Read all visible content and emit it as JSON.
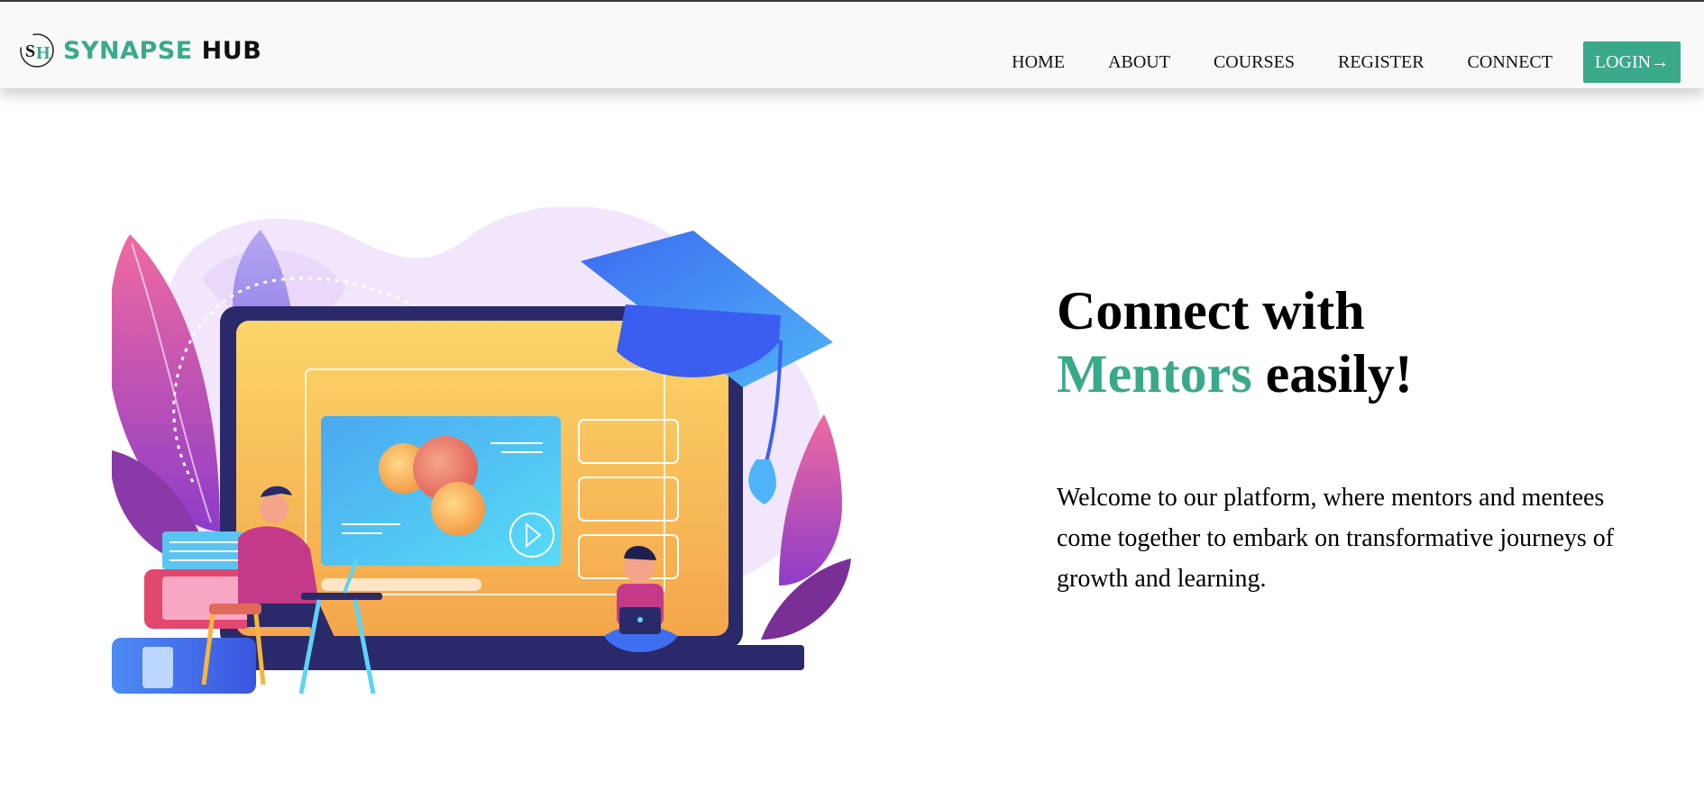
{
  "brand": {
    "logo_text": "SH",
    "name_part1": "SYNAPSE",
    "name_part2": "HUB"
  },
  "nav": {
    "home": "HOME",
    "about": "ABOUT",
    "courses": "COURSES",
    "register": "REGISTER",
    "connect": "CONNECT",
    "login": "LOGIN→"
  },
  "hero": {
    "headline_line1": "Connect with",
    "headline_accent": "Mentors",
    "headline_rest": " easily!",
    "description": "Welcome to our platform, where mentors and mentees come together to embark on transformative journeys of growth and learning."
  },
  "colors": {
    "accent": "#3aa98a",
    "navbar_bg": "#f9f9f9",
    "text": "#000000"
  },
  "icons": {
    "logo": "synapse-hub-logo-icon",
    "illustration": "online-learning-illustration"
  }
}
